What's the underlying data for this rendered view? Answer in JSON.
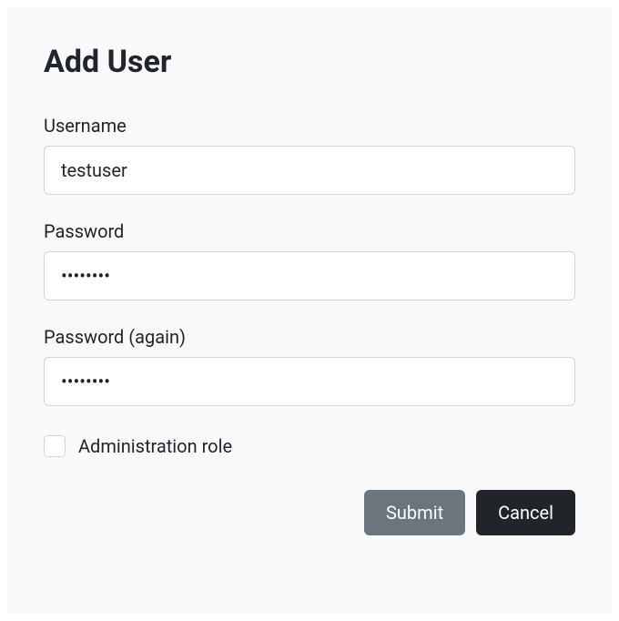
{
  "title": "Add User",
  "fields": {
    "username": {
      "label": "Username",
      "value": "testuser"
    },
    "password": {
      "label": "Password",
      "value": "••••••••"
    },
    "password_again": {
      "label": "Password (again)",
      "value": "••••••••"
    },
    "admin_role": {
      "label": "Administration role",
      "checked": false
    }
  },
  "buttons": {
    "submit": "Submit",
    "cancel": "Cancel"
  }
}
